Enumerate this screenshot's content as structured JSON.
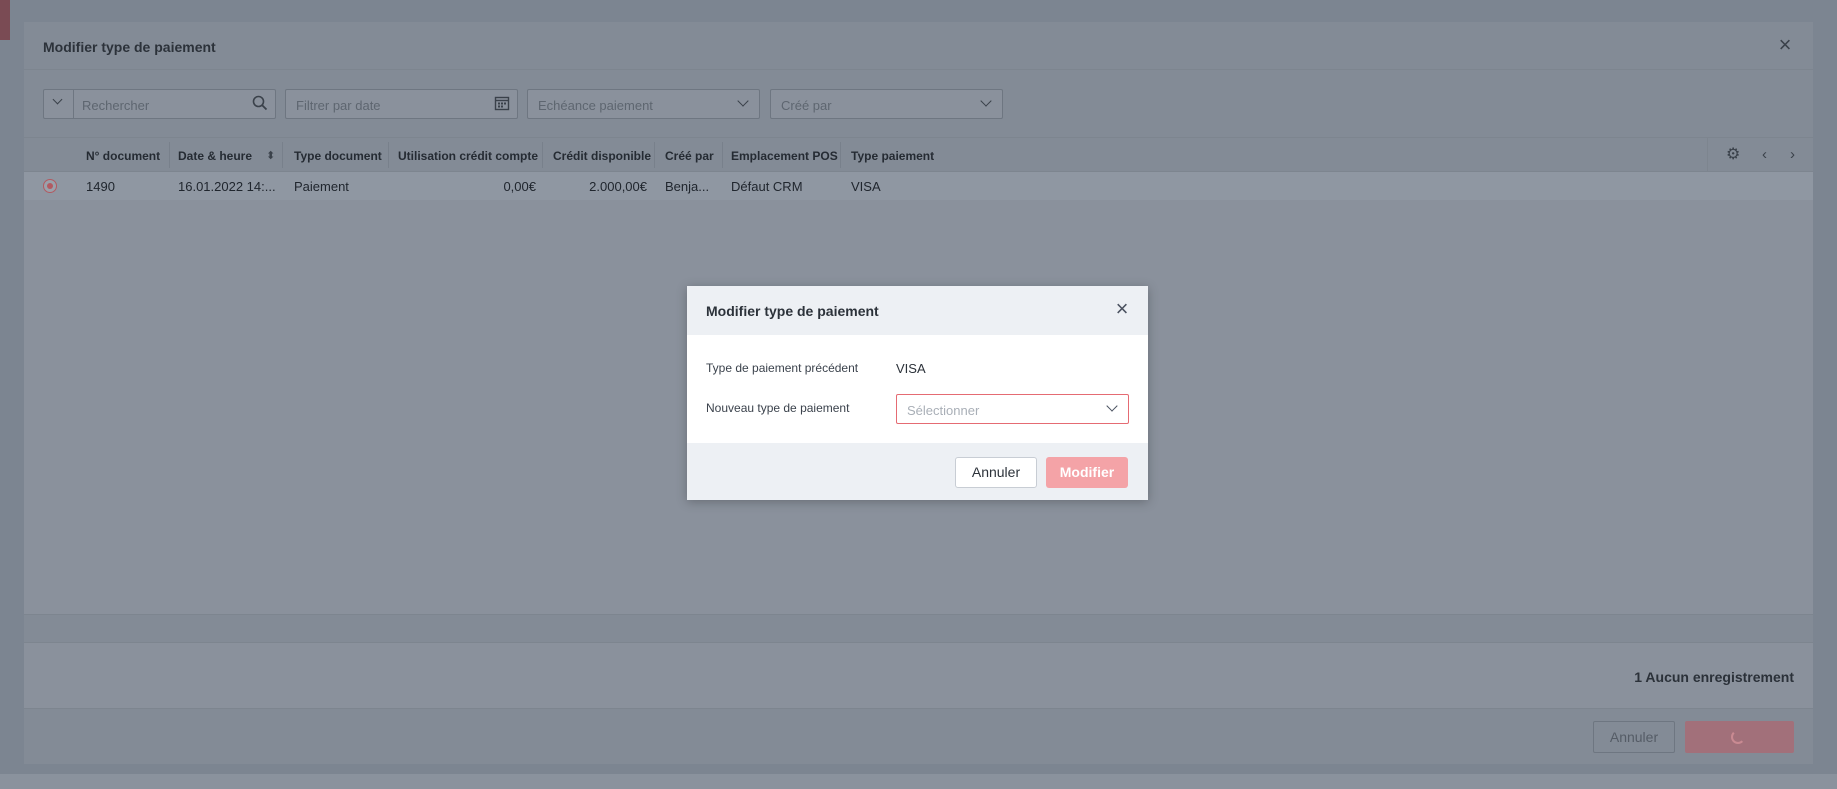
{
  "outer_dialog": {
    "title": "Modifier type de paiement",
    "filters": {
      "search_placeholder": "Rechercher",
      "date_placeholder": "Filtrer par date",
      "due_placeholder": "Echéance paiement",
      "creator_placeholder": "Créé par"
    },
    "columns": [
      "N° document",
      "Date & heure",
      "Type document",
      "Utilisation crédit compte",
      "Crédit disponible",
      "Créé par",
      "Emplacement POS",
      "Type paiement"
    ],
    "rows": [
      {
        "doc_no": "1490",
        "datetime": "16.01.2022 14:...",
        "doc_type": "Paiement",
        "credit_used": "0,00€",
        "credit_available": "2.000,00€",
        "created_by": "Benja...",
        "pos_location": "Défaut CRM",
        "payment_type": "VISA",
        "selected": true
      }
    ],
    "records_label": "1 Aucun enregistrement",
    "cancel_label": "Annuler"
  },
  "modal": {
    "title": "Modifier type de paiement",
    "previous_label": "Type de paiement précédent",
    "previous_value": "VISA",
    "new_label": "Nouveau type de paiement",
    "select_placeholder": "Sélectionner",
    "cancel_label": "Annuler",
    "modify_label": "Modifier"
  },
  "colors": {
    "accent_red": "#e56b73",
    "modify_button": "#f4a3a7",
    "overlay": "#8a919c"
  },
  "icons": {
    "close": "close-icon",
    "search": "search-icon",
    "calendar": "calendar-icon",
    "chevron": "chevron-down-icon",
    "settings": "gear-icon",
    "prev": "chevron-left-icon",
    "next": "chevron-right-icon"
  }
}
